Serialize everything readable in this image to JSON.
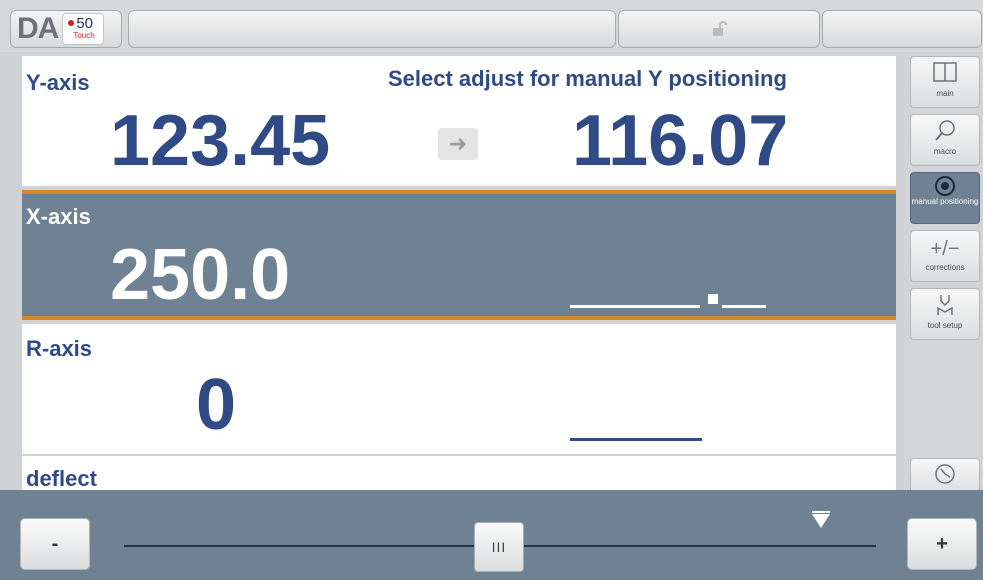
{
  "header": {
    "logo_text": "DA",
    "logo_model": "50",
    "logo_sub": "Touch",
    "lock_icon": "unlock-icon"
  },
  "y_axis": {
    "label": "Y-axis",
    "actual": "123.45",
    "message": "Select adjust for manual Y positioning",
    "target": "116.07"
  },
  "x_axis": {
    "label": "X-axis",
    "actual": "250.0",
    "target_placeholder": "_____._"
  },
  "r_axis": {
    "label": "R-axis",
    "actual": "0",
    "target_placeholder": "_____"
  },
  "deflect": {
    "label": "deflect"
  },
  "sidebar": {
    "items": [
      {
        "label": "main",
        "icon": "split-window-icon"
      },
      {
        "label": "macro",
        "icon": "magnifier-icon"
      },
      {
        "label": "manual positioning",
        "icon": "handwheel-icon",
        "active": true
      },
      {
        "label": "corrections",
        "icon": "plus-minus-icon"
      },
      {
        "label": "tool setup",
        "icon": "punch-die-icon"
      }
    ],
    "bottom_icon": "clock-icon"
  },
  "bottom": {
    "minus_label": "-",
    "plus_label": "+",
    "thumb_label": "III",
    "slider_position": 0.5
  },
  "colors": {
    "accent_blue": "#2f4a85",
    "selected_row": "#6f8294",
    "highlight_border": "#d08a2a"
  }
}
